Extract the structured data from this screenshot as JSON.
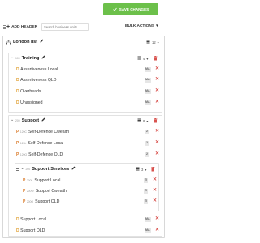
{
  "header": {
    "save_label": "SAVE CHANGES",
    "add_header_label": "ADD HEADER",
    "search_placeholder": "Search business units",
    "bulk_actions_label": "BULK ACTIONS"
  },
  "colors": {
    "save": "#6cc04a",
    "delete": "#d9534f",
    "folder_prefix": "#e0a033",
    "position_prefix": "#d97b2a"
  },
  "root": {
    "label": "London list",
    "count": "12"
  },
  "groups": {
    "training": {
      "code": "100",
      "label": "Training",
      "count": "4"
    },
    "support": {
      "code": "200",
      "label": "Support",
      "count": "8"
    },
    "support_services": {
      "code": "200",
      "label": "Support Services",
      "count": "3"
    }
  },
  "items": [
    {
      "prefix": "D",
      "code": "",
      "label": "Assertiveness Local",
      "badge": "MA"
    },
    {
      "prefix": "D",
      "code": "",
      "label": "Assertiveness QLD",
      "badge": "MA"
    },
    {
      "prefix": "D",
      "code": "",
      "label": "Overheads",
      "badge": "MA"
    },
    {
      "prefix": "D",
      "code": "",
      "label": "Unassigned",
      "badge": "MA"
    },
    {
      "prefix": "P",
      "code": "120C",
      "label": "Self-Defence Cwealth",
      "badge": "2"
    },
    {
      "prefix": "P",
      "code": "120L",
      "label": "Self-Defence Local",
      "badge": "2"
    },
    {
      "prefix": "P",
      "code": "120Q",
      "label": "Self-Defence QLD",
      "badge": "2"
    },
    {
      "prefix": "P",
      "code": "200L",
      "label": "Support Local",
      "badge": "TI"
    },
    {
      "prefix": "P",
      "code": "200W",
      "label": "Support Cwealth",
      "badge": "TI"
    },
    {
      "prefix": "P",
      "code": "200Q",
      "label": "Support QLD",
      "badge": "TI"
    },
    {
      "prefix": "D",
      "code": "",
      "label": "Support Local",
      "badge": "MA"
    },
    {
      "prefix": "D",
      "code": "",
      "label": "Support QLD",
      "badge": "MA"
    }
  ]
}
